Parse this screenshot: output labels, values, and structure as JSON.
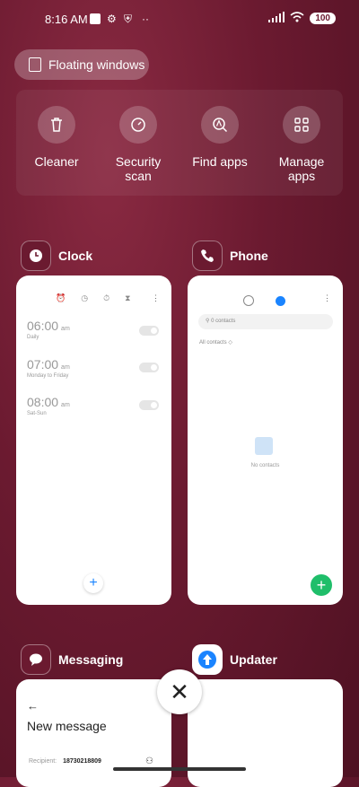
{
  "status": {
    "time": "8:16 AM",
    "battery": "100"
  },
  "floating_windows": {
    "label": "Floating windows"
  },
  "tools": [
    {
      "label": "Cleaner",
      "icon": "trash-icon"
    },
    {
      "label": "Security scan",
      "icon": "speedometer-icon"
    },
    {
      "label": "Find apps",
      "icon": "search-app-icon"
    },
    {
      "label": "Manage apps",
      "icon": "grid-icon"
    }
  ],
  "apps": {
    "clock": {
      "name": "Clock",
      "alarms": [
        {
          "time": "06:00",
          "ampm": "am",
          "repeat": "Daily"
        },
        {
          "time": "07:00",
          "ampm": "am",
          "repeat": "Monday to Friday"
        },
        {
          "time": "08:00",
          "ampm": "am",
          "repeat": "Sat-Sun"
        }
      ]
    },
    "phone": {
      "name": "Phone",
      "search_placeholder": "0 contacts",
      "filter": "All contacts",
      "empty": "No contacts"
    },
    "messaging": {
      "name": "Messaging",
      "title": "New message",
      "recipient_label": "Recipient:",
      "recipient_value": "18730218809"
    },
    "updater": {
      "name": "Updater"
    }
  },
  "colors": {
    "background": "#6b1a30",
    "accent_blue": "#1a84ff",
    "fab_green": "#1fbe6a"
  }
}
